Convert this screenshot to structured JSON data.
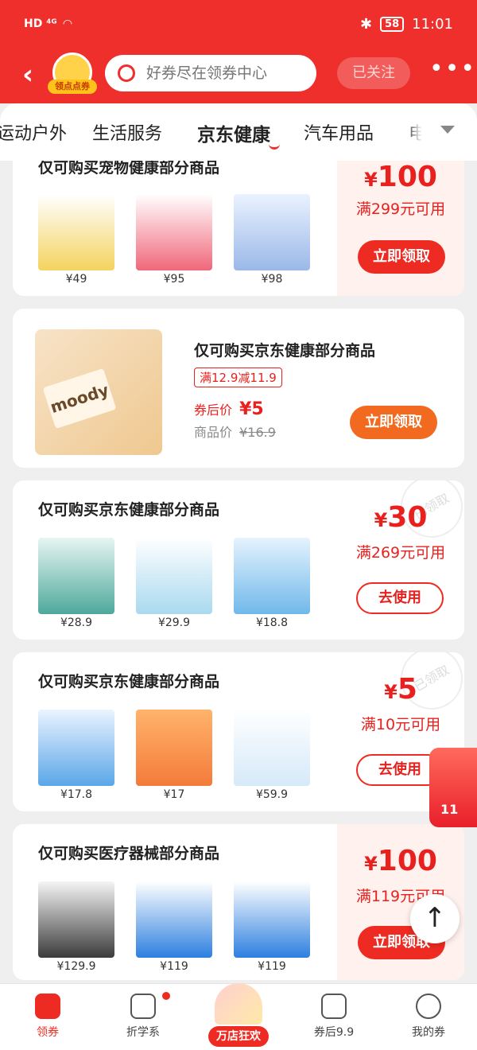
{
  "status_bar": {
    "left_icons": "HD ⁴ᴳ",
    "battery": "58",
    "time": "11:01"
  },
  "header": {
    "back_icon": "chevron-left-icon",
    "avatar_tag": "领点点券",
    "search_placeholder": "好券尽在领券中心",
    "follow_label": "已关注",
    "more_icon": "more-dots-icon"
  },
  "tabs": {
    "items": [
      "运动户外",
      "生活服务",
      "京东健康",
      "汽车用品",
      "电"
    ],
    "active_index": 2
  },
  "coupons": [
    {
      "title": "仅可购买宠物健康部分商品",
      "products": [
        {
          "price": "¥49",
          "color": "#f4d35e"
        },
        {
          "price": "¥95",
          "color": "#f0677a"
        },
        {
          "price": "¥98",
          "color": "#9ab8e8"
        }
      ],
      "amount": "100",
      "condition": "满299元可用",
      "button": "立即领取"
    },
    {
      "title": "仅可购买京东健康部分商品",
      "tag": "满12.9减11.9",
      "after_label": "券后价",
      "after_price": "¥5",
      "orig_label": "商品价",
      "orig_price": "¥16.9",
      "button": "立即领取"
    },
    {
      "title": "仅可购买京东健康部分商品",
      "products": [
        {
          "price": "¥28.9",
          "color": "#4ea89c"
        },
        {
          "price": "¥29.9",
          "color": "#a9d9ef"
        },
        {
          "price": "¥18.8",
          "color": "#70b8ea"
        }
      ],
      "amount": "30",
      "condition": "满269元可用",
      "button": "去使用",
      "stamp": "已领取"
    },
    {
      "title": "仅可购买京东健康部分商品",
      "products": [
        {
          "price": "¥17.8",
          "color": "#5aa6e8"
        },
        {
          "price": "¥17",
          "color": "#f47b3a"
        },
        {
          "price": "¥59.9",
          "color": "#e9f3fb"
        }
      ],
      "amount": "5",
      "condition": "满10元可用",
      "button": "去使用",
      "stamp": "已领取"
    },
    {
      "title": "仅可购买医疗器械部分商品",
      "products": [
        {
          "price": "¥129.9",
          "color": "#3b3b3b"
        },
        {
          "price": "¥119",
          "color": "#2d7fe0"
        },
        {
          "price": "¥119",
          "color": "#2d7fe0"
        }
      ],
      "amount": "100",
      "condition": "满119元可用",
      "button": "立即领取"
    }
  ],
  "bottom_nav": [
    {
      "label": "领券",
      "icon": "coupon-icon",
      "active": true
    },
    {
      "label": "折学系",
      "icon": "z-logo-icon",
      "active": false
    },
    {
      "label": "万店狂欢",
      "icon": "festival-icon",
      "active": false
    },
    {
      "label": "券后9.9",
      "icon": "price-99-icon",
      "active": false
    },
    {
      "label": "我的券",
      "icon": "smile-icon",
      "active": false
    }
  ],
  "floating": {
    "bag_text": "11",
    "to_top_icon": "arrow-up-icon"
  },
  "colors": {
    "brand_red": "#ef2f2c",
    "accent_red": "#ee2b22",
    "highlight_red": "#e8211e",
    "panel_bg": "#fff1ee"
  }
}
